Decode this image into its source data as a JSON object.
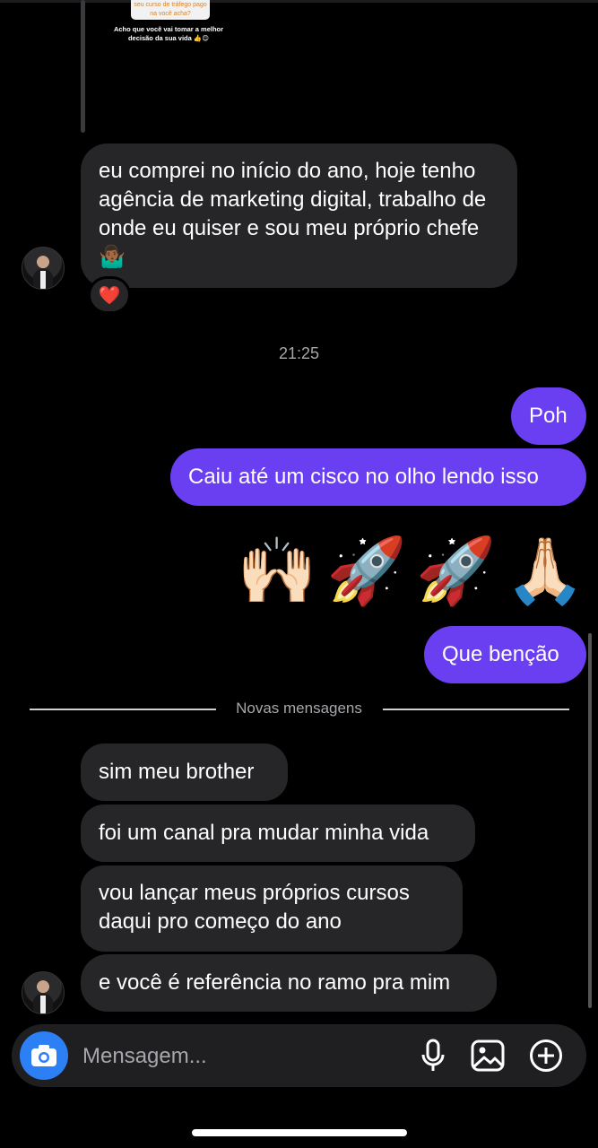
{
  "story_reply": {
    "story_top_text": "seu curso de tráfego pago na você acha?",
    "story_caption": "Acho que você vai tomar a melhor decisão da sua vida 👍😊"
  },
  "messages_top": {
    "incoming_1": "eu comprei no início do ano, hoje tenho agência de marketing digital, trabalho de onde eu quiser e sou meu próprio chefe 🤷🏾‍♂️",
    "reaction": "❤️"
  },
  "timestamp": "21:25",
  "outgoing": {
    "msg_1": "Poh",
    "msg_2": "Caiu até um cisco no olho lendo isso",
    "emojis": [
      "🙌🏻",
      "🚀",
      "🚀",
      "🙏🏻"
    ],
    "msg_3": "Que benção"
  },
  "new_messages_divider": "Novas mensagens",
  "incoming_new": {
    "msg_1": "sim meu brother",
    "msg_2": "foi um canal pra mudar minha vida",
    "msg_3": "vou lançar meus próprios cursos daqui pro começo do ano",
    "msg_4": "e você é referência no ramo pra mim"
  },
  "composer": {
    "placeholder": "Mensagem...",
    "icons": [
      "camera-icon",
      "microphone-icon",
      "gallery-icon",
      "plus-icon"
    ]
  },
  "colors": {
    "outgoing_bubble": "#6a3ff2",
    "incoming_bubble": "#262629",
    "camera_button": "#2d7ff5",
    "background": "#000000"
  }
}
